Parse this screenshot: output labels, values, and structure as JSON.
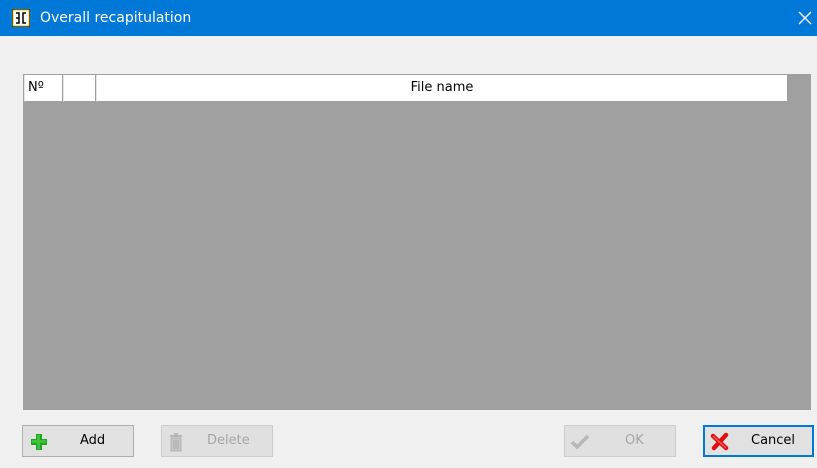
{
  "window": {
    "title": "Overall recapitulation",
    "accent_color": "#0078d7",
    "icons": {
      "app": "dual-bracket-app-icon",
      "close": "close-icon"
    }
  },
  "grid": {
    "columns": [
      {
        "label": "Nº"
      },
      {
        "label": ""
      },
      {
        "label": "File name"
      }
    ],
    "rows": []
  },
  "buttons": {
    "add": {
      "label": "Add",
      "icon": "plus-icon",
      "enabled": true
    },
    "delete": {
      "label": "Delete",
      "icon": "trash-icon",
      "enabled": false
    },
    "ok": {
      "label": "OK",
      "icon": "checkmark-icon",
      "enabled": false
    },
    "cancel": {
      "label": "Cancel",
      "icon": "red-x-icon",
      "enabled": true,
      "default": true
    }
  }
}
